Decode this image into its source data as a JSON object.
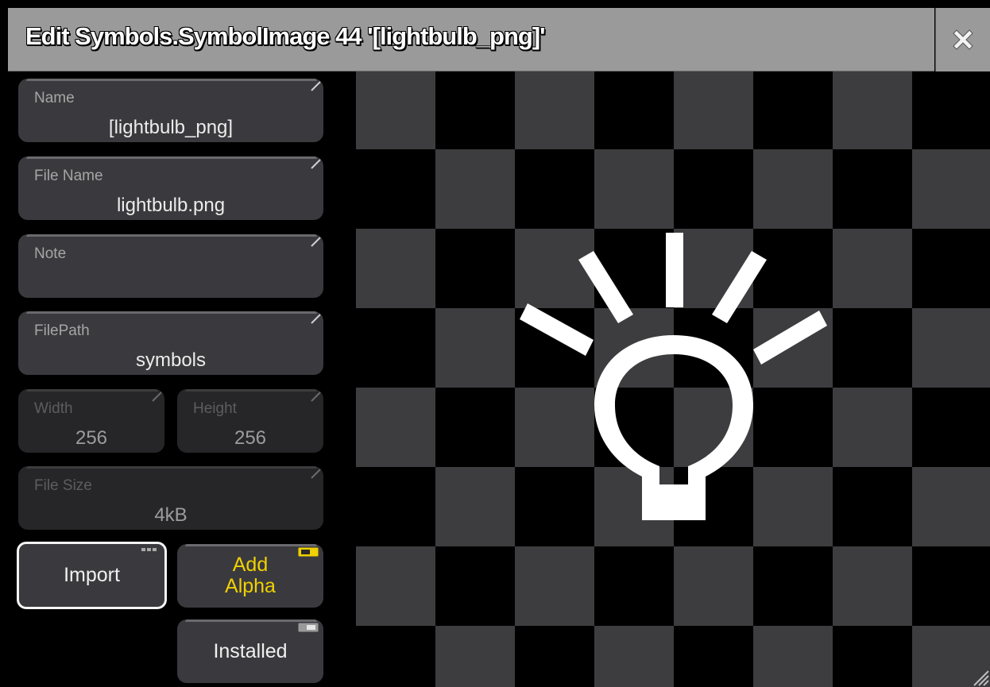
{
  "window": {
    "title": "Edit Symbols.SymbolImage 44 '[lightbulb_png]'",
    "close_icon": "close-x-icon"
  },
  "fields": {
    "name": {
      "label": "Name",
      "value": "[lightbulb_png]"
    },
    "file_name": {
      "label": "File Name",
      "value": "lightbulb.png"
    },
    "note": {
      "label": "Note",
      "value": ""
    },
    "file_path": {
      "label": "FilePath",
      "value": "symbols"
    },
    "width": {
      "label": "Width",
      "value": "256"
    },
    "height": {
      "label": "Height",
      "value": "256"
    },
    "file_size": {
      "label": "File Size",
      "value": "4kB"
    }
  },
  "buttons": {
    "import": {
      "label": "Import",
      "icon": "more-dots-icon"
    },
    "add_alpha": {
      "label_line1": "Add",
      "label_line2": "Alpha",
      "state": "on",
      "icon": "toggle-on-icon"
    },
    "installed": {
      "label": "Installed",
      "state": "off",
      "icon": "toggle-off-icon"
    }
  },
  "preview": {
    "image": "lightbulb-icon",
    "background": "checkerboard"
  },
  "colors": {
    "title_bar": "#9a9a9a",
    "field_bg": "#3a3a3e",
    "accent_yellow": "#f0d000",
    "checker_dark": "#000000",
    "checker_light": "#3d3d3f"
  }
}
